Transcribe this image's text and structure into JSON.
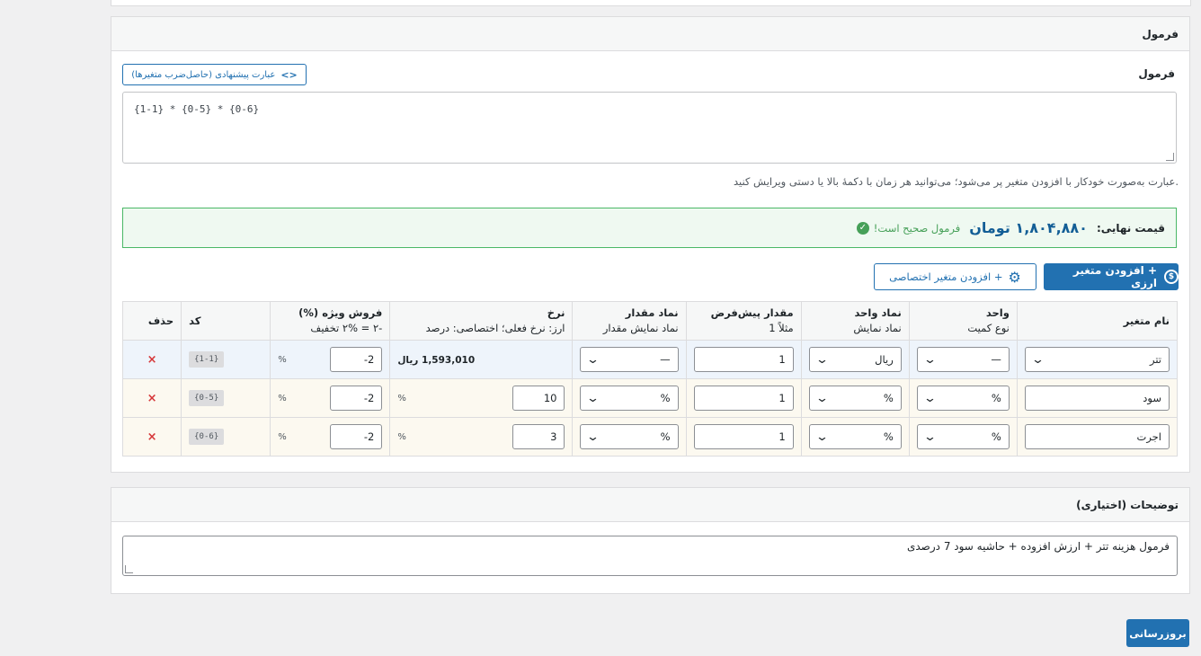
{
  "formula_panel": {
    "title": "فرمول",
    "label": "فرمول",
    "suggest_button": "عبارت پیشنهادی (حاصل‌ضرب متغیرها)",
    "suggest_icon": "code-icon",
    "formula_value": "{1-1} * {0-5} * {0-6}",
    "help_text": "عبارت به‌صورت خودکار با افزودن متغیر پر می‌شود؛ می‌توانید هر زمان با دکمهٔ بالا یا دستی ویرایش کنید.",
    "result": {
      "label": "قیمت نهایی:",
      "price": "۱,۸۰۴,۸۸۰ تومان",
      "valid_text": "فرمول صحیح است!",
      "valid_icon": "check-circle-icon"
    },
    "add_currency_button": "+ افزودن متغیر ارزی",
    "add_currency_icon": "currency-icon",
    "add_custom_button": "+ افزودن متغیر اختصاصی",
    "add_custom_icon": "gear-icon"
  },
  "table": {
    "headers": {
      "name": {
        "title": "نام متغیر",
        "sub": ""
      },
      "unit": {
        "title": "واحد",
        "sub": "نوع کمیت"
      },
      "unit_symbol": {
        "title": "نماد واحد",
        "sub": "نماد نمایش"
      },
      "default_value": {
        "title": "مقدار پیش‌فرض",
        "sub": "مثلاً 1"
      },
      "value_symbol": {
        "title": "نماد مقدار",
        "sub": "نماد نمایش مقدار"
      },
      "rate": {
        "title": "نرخ",
        "sub": "ارز: نرخ فعلی؛ اختصاصی: درصد"
      },
      "special_sale": {
        "title": "فروش ویژه (%)",
        "sub": "-۲ = ۲% تخفیف"
      },
      "code": {
        "title": "کد",
        "sub": ""
      },
      "delete": {
        "title": "حذف",
        "sub": ""
      }
    },
    "rows": [
      {
        "name": "تتر",
        "unit": "—",
        "unit_symbol": "ریال",
        "default_value": "1",
        "value_symbol": "—",
        "rate_text": "1,593,010 ریال",
        "special_sale": "-2",
        "pct": "%",
        "code": "{1-1}",
        "delete": "×"
      },
      {
        "name": "سود",
        "unit": "%",
        "unit_symbol": "%",
        "default_value": "1",
        "value_symbol": "%",
        "rate_value": "10",
        "rate_pct": "%",
        "special_sale": "-2",
        "pct": "%",
        "code": "{0-5}",
        "delete": "×"
      },
      {
        "name": "اجرت",
        "unit": "%",
        "unit_symbol": "%",
        "default_value": "1",
        "value_symbol": "%",
        "rate_value": "3",
        "rate_pct": "%",
        "special_sale": "-2",
        "pct": "%",
        "code": "{0-6}",
        "delete": "×"
      }
    ]
  },
  "description_panel": {
    "title": "توضیحات (اختیاری)",
    "value": "فرمول هزینه تتر + ارزش افزوده + حاشیه سود 7 درصدی"
  },
  "update_button": "بروزرسانی",
  "colors": {
    "primary": "#2271b1",
    "success": "#46a058",
    "danger": "#d63638"
  }
}
